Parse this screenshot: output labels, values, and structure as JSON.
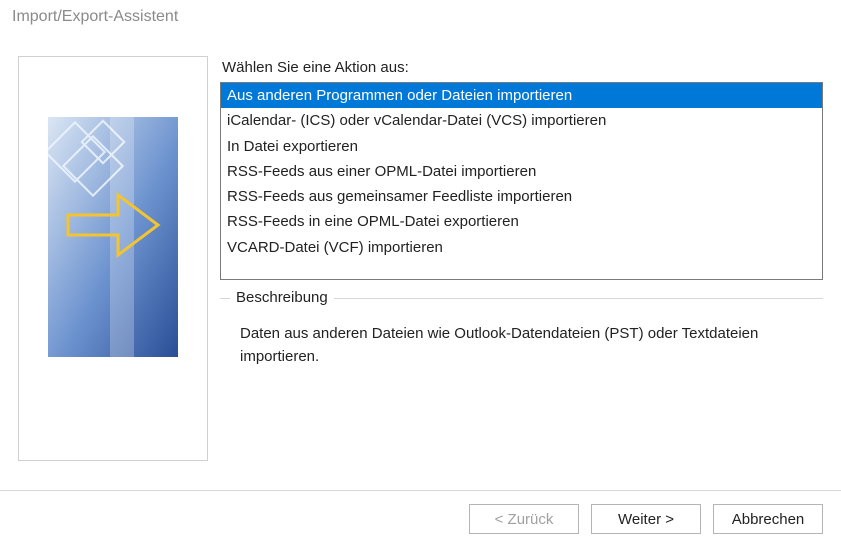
{
  "window": {
    "title": "Import/Export-Assistent"
  },
  "main": {
    "prompt": "Wählen Sie eine Aktion aus:",
    "actions": [
      {
        "label": "Aus anderen Programmen oder Dateien importieren",
        "selected": true
      },
      {
        "label": "iCalendar- (ICS) oder vCalendar-Datei (VCS) importieren",
        "selected": false
      },
      {
        "label": "In Datei exportieren",
        "selected": false
      },
      {
        "label": "RSS-Feeds aus einer OPML-Datei importieren",
        "selected": false
      },
      {
        "label": "RSS-Feeds aus gemeinsamer Feedliste importieren",
        "selected": false
      },
      {
        "label": "RSS-Feeds in eine OPML-Datei exportieren",
        "selected": false
      },
      {
        "label": "VCARD-Datei (VCF) importieren",
        "selected": false
      }
    ],
    "description_label": "Beschreibung",
    "description_text": "Daten aus anderen Dateien wie Outlook-Datendateien (PST) oder Textdateien importieren."
  },
  "buttons": {
    "back": "< Zurück",
    "next": "Weiter >",
    "cancel": "Abbrechen"
  }
}
